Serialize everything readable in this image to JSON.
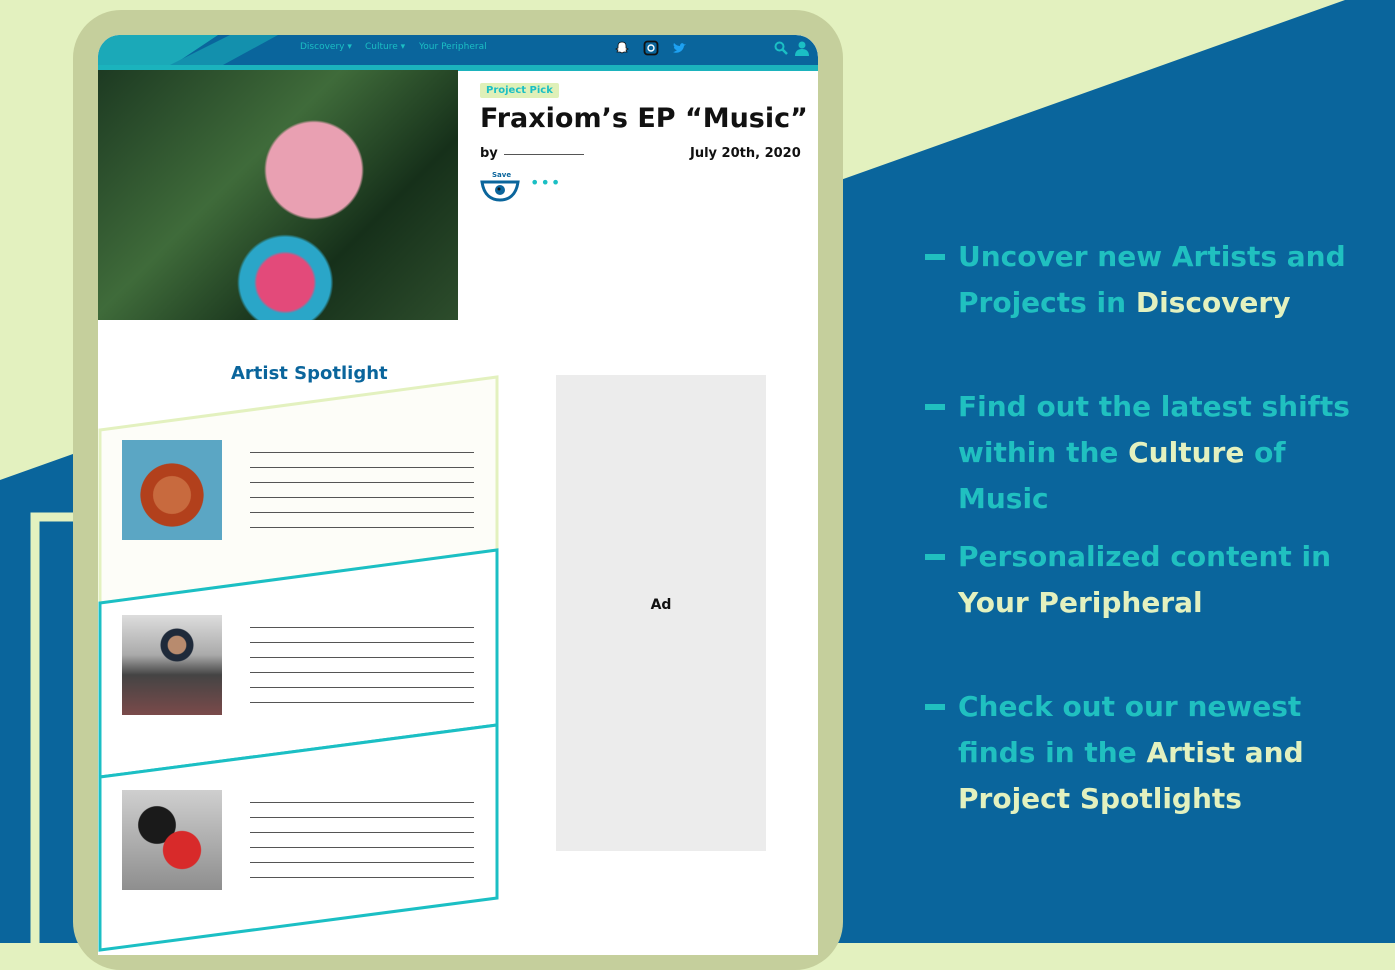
{
  "nav": {
    "links": [
      "Discovery ▾",
      "Culture ▾",
      "Your Peripheral"
    ]
  },
  "article": {
    "badge": "Project Pick",
    "title": "Fraxiom’s EP “Music”",
    "by": "by",
    "date": "July 20th, 2020",
    "save": "Save",
    "more": "•••"
  },
  "spotlight": {
    "title": "Artist Spotlight",
    "ad": "Ad"
  },
  "features": [
    {
      "pre": "Uncover new Artists and Projects in ",
      "hl": "Discovery",
      "post": ""
    },
    {
      "pre": "Find out the latest shifts within the ",
      "hl": "Culture",
      "post": " of Music"
    },
    {
      "pre": "Personalized content in ",
      "hl": "Your Peripheral",
      "post": ""
    },
    {
      "pre": "Check out our newest finds in the ",
      "hl": "Artist and Project Spotlights",
      "post": ""
    }
  ],
  "colors": {
    "blue": "#0a659c",
    "teal": "#20c0c0",
    "lime": "#e3f1bf"
  }
}
